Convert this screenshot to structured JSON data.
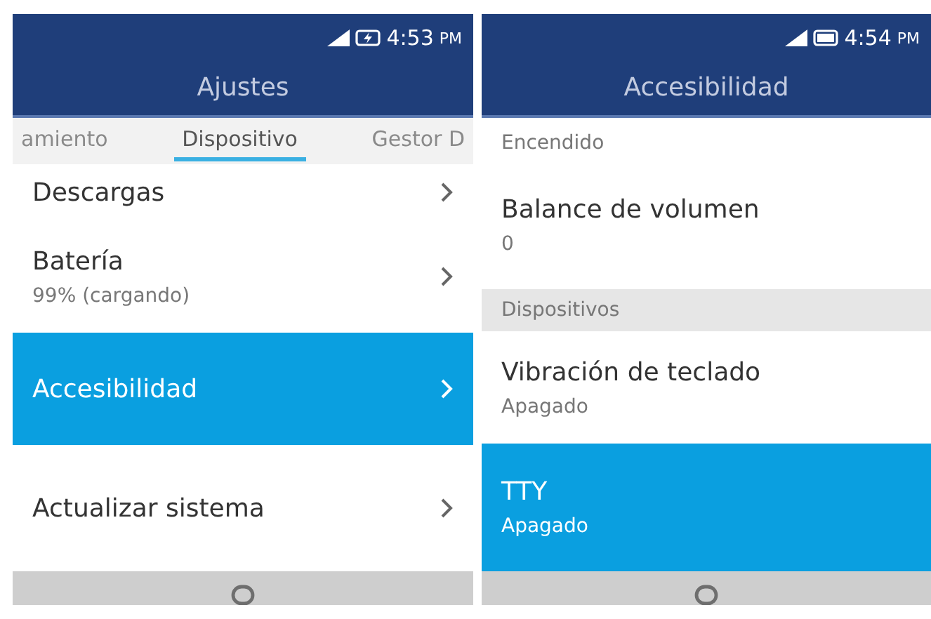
{
  "screens": [
    {
      "status_bar": {
        "time": "4:53",
        "meridiem": "PM",
        "charging": true
      },
      "title": "Ajustes",
      "tabs": [
        {
          "label": "amiento",
          "selected": false
        },
        {
          "label": "Dispositivo",
          "selected": true
        },
        {
          "label": "Gestor D",
          "selected": false
        }
      ],
      "items": [
        {
          "kind": "setting",
          "title": "Descargas",
          "chevron": true,
          "selected": false
        },
        {
          "kind": "setting",
          "title": "Batería",
          "subtitle": "99% (cargando)",
          "chevron": true,
          "selected": false
        },
        {
          "kind": "setting",
          "title": "Accesibilidad",
          "chevron": true,
          "selected": true
        },
        {
          "kind": "setting",
          "title": "Actualizar sistema",
          "chevron": true,
          "selected": false
        }
      ]
    },
    {
      "status_bar": {
        "time": "4:54",
        "meridiem": "PM",
        "charging": false
      },
      "title": "Accesibilidad",
      "items": [
        {
          "kind": "value",
          "subtitle": "Encendido",
          "selected": false
        },
        {
          "kind": "setting",
          "title": "Balance de volumen",
          "subtitle": "0",
          "chevron": false,
          "selected": false
        },
        {
          "kind": "header",
          "title": "Dispositivos"
        },
        {
          "kind": "setting",
          "title": "Vibración de teclado",
          "subtitle": "Apagado",
          "chevron": false,
          "selected": false
        },
        {
          "kind": "setting",
          "title": "TTY",
          "subtitle": "Apagado",
          "chevron": false,
          "selected": true
        }
      ]
    }
  ]
}
